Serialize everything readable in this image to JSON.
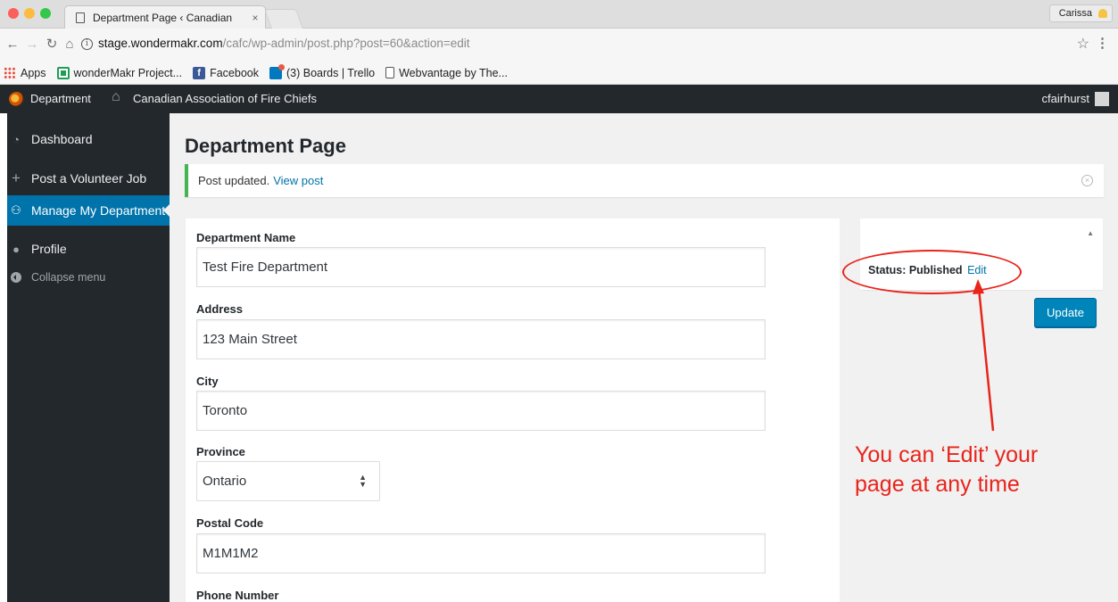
{
  "browser": {
    "tab_title": "Department Page ‹ Canadian",
    "tab_close": "×",
    "profile_name": "Carissa",
    "url_host": "stage.wondermakr.com",
    "url_path": "/cafc/wp-admin/post.php?post=60&action=edit",
    "bookmarks": [
      {
        "label": "Apps",
        "icon": "apps-grid-icon"
      },
      {
        "label": "wonderMakr Project...",
        "icon": "spreadsheet-icon"
      },
      {
        "label": "Facebook",
        "icon": "facebook-icon"
      },
      {
        "label": "(3) Boards | Trello",
        "icon": "trello-icon"
      },
      {
        "label": "Webvantage by The...",
        "icon": "document-icon"
      }
    ]
  },
  "adminbar": {
    "site_menu": "Department",
    "site_name": "Canadian Association of Fire Chiefs",
    "user": "cfairhurst"
  },
  "sidebar": {
    "items": [
      {
        "label": "Dashboard",
        "icon": "dashboard-icon"
      },
      {
        "label": "Post a Volunteer Job",
        "icon": "plus-icon"
      },
      {
        "label": "Manage My Department",
        "icon": "department-icon",
        "active": true
      },
      {
        "label": "Profile",
        "icon": "user-icon"
      },
      {
        "label": "Collapse menu",
        "icon": "collapse-icon"
      }
    ]
  },
  "main": {
    "page_title": "Department Page",
    "notice_text": "Post updated.",
    "notice_link": "View post",
    "fields": {
      "department_name_label": "Department Name",
      "department_name_value": "Test Fire Department",
      "address_label": "Address",
      "address_value": "123 Main Street",
      "city_label": "City",
      "city_value": "Toronto",
      "province_label": "Province",
      "province_value": "Ontario",
      "postal_code_label": "Postal Code",
      "postal_code_value": "M1M1M2",
      "phone_label": "Phone Number"
    },
    "publish": {
      "status_label": "Status: Published",
      "edit_link": "Edit",
      "update_button": "Update"
    }
  },
  "annotation": {
    "line1": "You can ‘Edit’ your",
    "line2": "page at any time",
    "color": "#e8241b"
  },
  "colors": {
    "admin_dark": "#23282d",
    "wp_blue": "#0073aa",
    "button_blue": "#0085ba",
    "notice_green": "#46b450"
  }
}
